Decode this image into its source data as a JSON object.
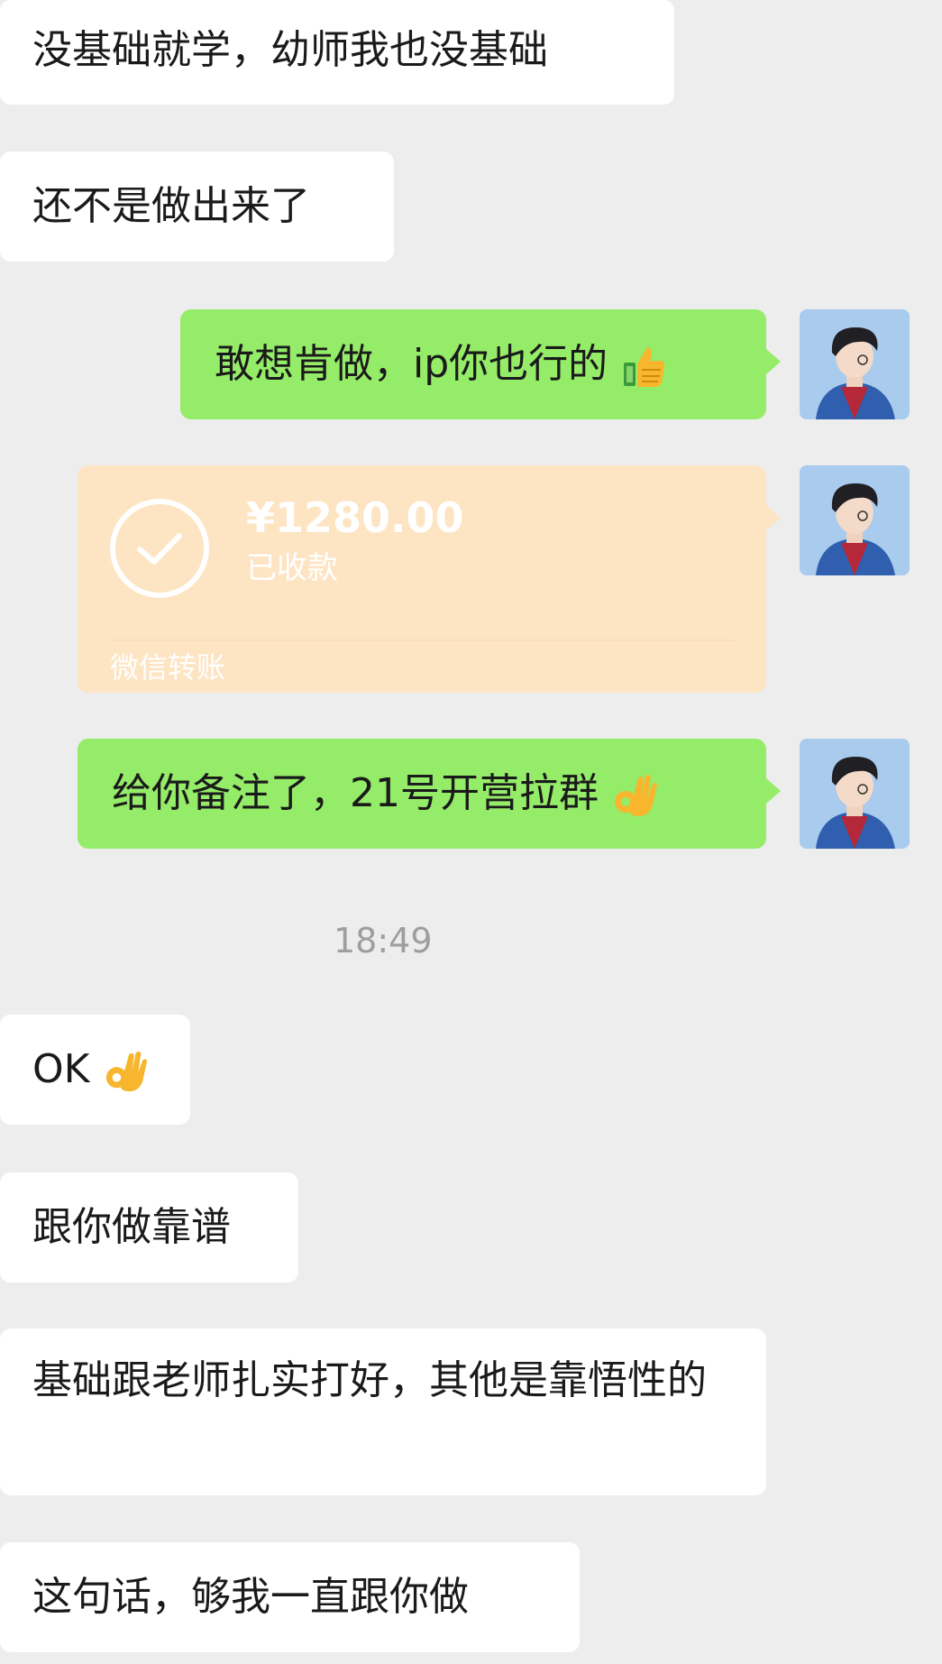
{
  "messages": {
    "m1": "没基础就学，幼师我也没基础",
    "m2": "还不是做出来了",
    "m3": "敢想肯做，ip你也行的",
    "m3_emoji": "thumbs-up",
    "m5": "给你备注了，21号开营拉群",
    "m5_emoji": "ok-hand",
    "m6": "OK",
    "m6_emoji": "ok-hand",
    "m7": "跟你做靠谱",
    "m8": "基础跟老师扎实打好，其他是靠悟性的",
    "m9": "这句话，够我一直跟你做"
  },
  "transfer": {
    "amount": "¥1280.00",
    "status": "已收款",
    "footer": "微信转账",
    "icon": "check-circle-icon"
  },
  "timestamp": "18:49",
  "colors": {
    "background": "#ededed",
    "incoming_bubble": "#ffffff",
    "outgoing_bubble": "#95ec69",
    "transfer_card": "#fde4c3"
  }
}
